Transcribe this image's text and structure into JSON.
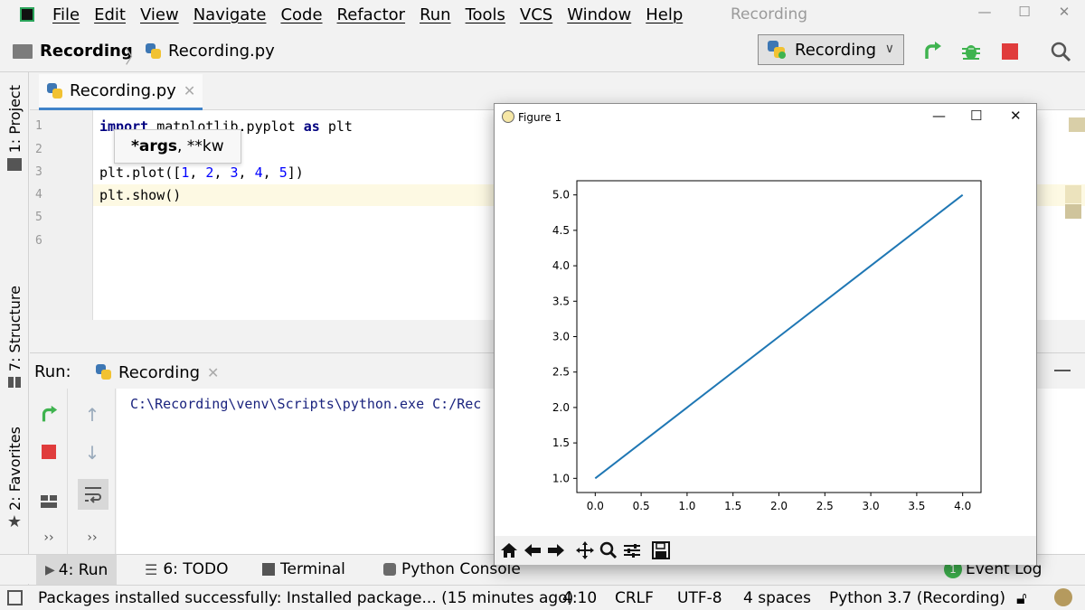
{
  "menubar": {
    "items": [
      "File",
      "Edit",
      "View",
      "Navigate",
      "Code",
      "Refactor",
      "Run",
      "Tools",
      "VCS",
      "Window",
      "Help"
    ],
    "window_title": "Recording",
    "minimize": "—",
    "maximize": "☐",
    "close": "✕"
  },
  "navbar": {
    "project": "Recording",
    "file": "Recording.py",
    "run_config": "Recording"
  },
  "left_stripe": {
    "project_tab": "1: Project",
    "structure_tab": "7: Structure",
    "favorites_tab": "2: Favorites"
  },
  "editor": {
    "tab_label": "Recording.py",
    "line_numbers": [
      "1",
      "2",
      "3",
      "4",
      "5",
      "6"
    ],
    "code": {
      "l1_kw": "import",
      "l1_rest": " matplotlib.pyplot ",
      "l1_as": "as",
      "l1_end": " plt",
      "l3_a": "plt.plot([",
      "l3_n1": "1",
      "l3_n2": "2",
      "l3_n3": "3",
      "l3_n4": "4",
      "l3_n5": "5",
      "l3_end": "])",
      "l4": "plt.show()"
    },
    "param_hint_bold": "*args",
    "param_hint_rest": ", **kw"
  },
  "run_panel": {
    "label": "Run:",
    "tab": "Recording",
    "command": "C:\\Recording\\venv\\Scripts\\python.exe C:/Rec"
  },
  "bottom_tabs": {
    "run": "4: Run",
    "todo": "6: TODO",
    "terminal": "Terminal",
    "python_console": "Python Console",
    "event_log_count": "1",
    "event_log": "Event Log"
  },
  "statusbar": {
    "message": "Packages installed successfully: Installed package... (15 minutes ago)",
    "position": "4:10",
    "line_sep": "CRLF",
    "encoding": "UTF-8",
    "indent": "4 spaces",
    "interpreter": "Python 3.7 (Recording)"
  },
  "figure": {
    "title": "Figure 1",
    "minimize": "—",
    "maximize": "☐",
    "close": "✕",
    "toolbar": [
      "home-icon",
      "back-arrow-icon",
      "forward-arrow-icon",
      "pan-icon",
      "zoom-icon",
      "configure-icon",
      "save-icon"
    ]
  },
  "chart_data": {
    "type": "line",
    "title": "",
    "xlabel": "",
    "ylabel": "",
    "x": [
      0,
      1,
      2,
      3,
      4
    ],
    "series": [
      {
        "values": [
          1,
          2,
          3,
          4,
          5
        ],
        "color": "#1f77b4"
      }
    ],
    "xlim": [
      -0.2,
      4.2
    ],
    "ylim": [
      0.8,
      5.2
    ],
    "xticks": [
      "0.0",
      "0.5",
      "1.0",
      "1.5",
      "2.0",
      "2.5",
      "3.0",
      "3.5",
      "4.0"
    ],
    "yticks": [
      "1.0",
      "1.5",
      "2.0",
      "2.5",
      "3.0",
      "3.5",
      "4.0",
      "4.5",
      "5.0"
    ],
    "grid": false,
    "legend": "none"
  },
  "colors": {
    "accent": "#4083c9",
    "run_green": "#3fb34f",
    "stop_red": "#e03c3c",
    "line_blue": "#1f77b4"
  }
}
